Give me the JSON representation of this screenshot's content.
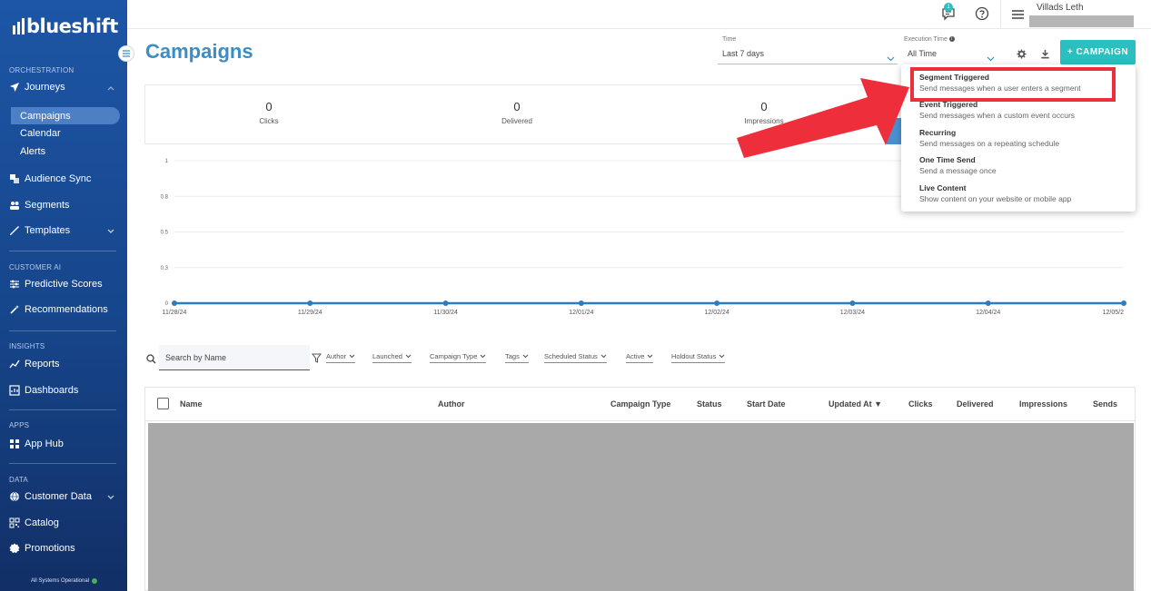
{
  "sidebar": {
    "logo": "blueshift",
    "sections": {
      "orchestration": "ORCHESTRATION",
      "customer_ai": "CUSTOMER AI",
      "insights": "INSIGHTS",
      "apps": "APPS",
      "data": "DATA"
    },
    "items": {
      "journeys": "Journeys",
      "campaigns": "Campaigns",
      "calendar": "Calendar",
      "alerts": "Alerts",
      "audience_sync": "Audience Sync",
      "segments": "Segments",
      "templates": "Templates",
      "predictive_scores": "Predictive Scores",
      "recommendations": "Recommendations",
      "reports": "Reports",
      "dashboards": "Dashboards",
      "app_hub": "App Hub",
      "customer_data": "Customer Data",
      "catalog": "Catalog",
      "promotions": "Promotions"
    },
    "status": "All Systems Operational",
    "accent": "#1d56a6"
  },
  "topbar": {
    "notification_count": "1",
    "user_name": "Villads Leth"
  },
  "header": {
    "title": "Campaigns",
    "time_label": "Time",
    "time_value": "Last 7 days",
    "exec_label": "Execution Time",
    "exec_value": "All Time",
    "campaign_button": "+ CAMPAIGN",
    "accent": "#2bbfbf"
  },
  "stats": [
    {
      "value": "0",
      "label": "Clicks"
    },
    {
      "value": "0",
      "label": "Delivered"
    },
    {
      "value": "0",
      "label": "Impressions"
    }
  ],
  "chart_data": {
    "type": "line",
    "x": [
      "11/28/24",
      "11/29/24",
      "11/30/24",
      "12/01/24",
      "12/02/24",
      "12/03/24",
      "12/04/24",
      "12/05/2"
    ],
    "series": [
      {
        "values": [
          0,
          0,
          0,
          0,
          0,
          0,
          0,
          0
        ]
      }
    ],
    "yticks": [
      "1",
      "0.8",
      "0.5",
      "0.3",
      "0"
    ],
    "ylim": [
      0,
      1
    ],
    "grid": true,
    "color": "#2e7cc0"
  },
  "dropdown": {
    "items": [
      {
        "title": "Segment Triggered",
        "desc": "Send messages when a user enters a segment"
      },
      {
        "title": "Event Triggered",
        "desc": "Send messages when a custom event occurs"
      },
      {
        "title": "Recurring",
        "desc": "Send messages on a repeating schedule"
      },
      {
        "title": "One Time Send",
        "desc": "Send a message once"
      },
      {
        "title": "Live Content",
        "desc": "Show content on your website or mobile app"
      }
    ]
  },
  "filters": {
    "search_placeholder": "Search by Name",
    "chips": [
      "Author",
      "Launched",
      "Campaign Type",
      "Tags",
      "Scheduled Status",
      "Active",
      "Holdout Status"
    ]
  },
  "table": {
    "columns": [
      "Name",
      "Author",
      "Campaign Type",
      "Status",
      "Start Date",
      "Updated At ▼",
      "Clicks",
      "Delivered",
      "Impressions",
      "Sends"
    ]
  }
}
